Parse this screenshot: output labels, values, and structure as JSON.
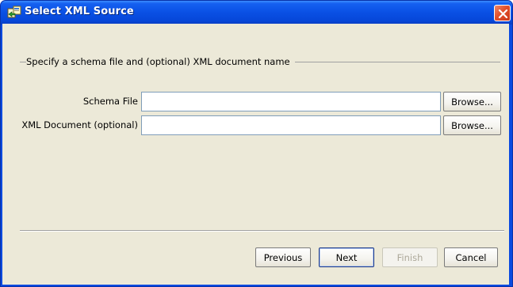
{
  "window": {
    "title": "Select XML Source",
    "app_icon": "xml-source-icon",
    "close_icon": "close-icon",
    "colors": {
      "titlebar": "#0a50e4",
      "client": "#ece9d8",
      "close": "#e2502c"
    }
  },
  "group": {
    "title": "Specify a schema file and (optional) XML document name"
  },
  "fields": [
    {
      "label": "Schema File",
      "value": "",
      "button": "Browse..."
    },
    {
      "label": "XML Document (optional)",
      "value": "",
      "button": "Browse..."
    }
  ],
  "footer": {
    "previous": "Previous",
    "next": "Next",
    "finish": "Finish",
    "cancel": "Cancel"
  }
}
